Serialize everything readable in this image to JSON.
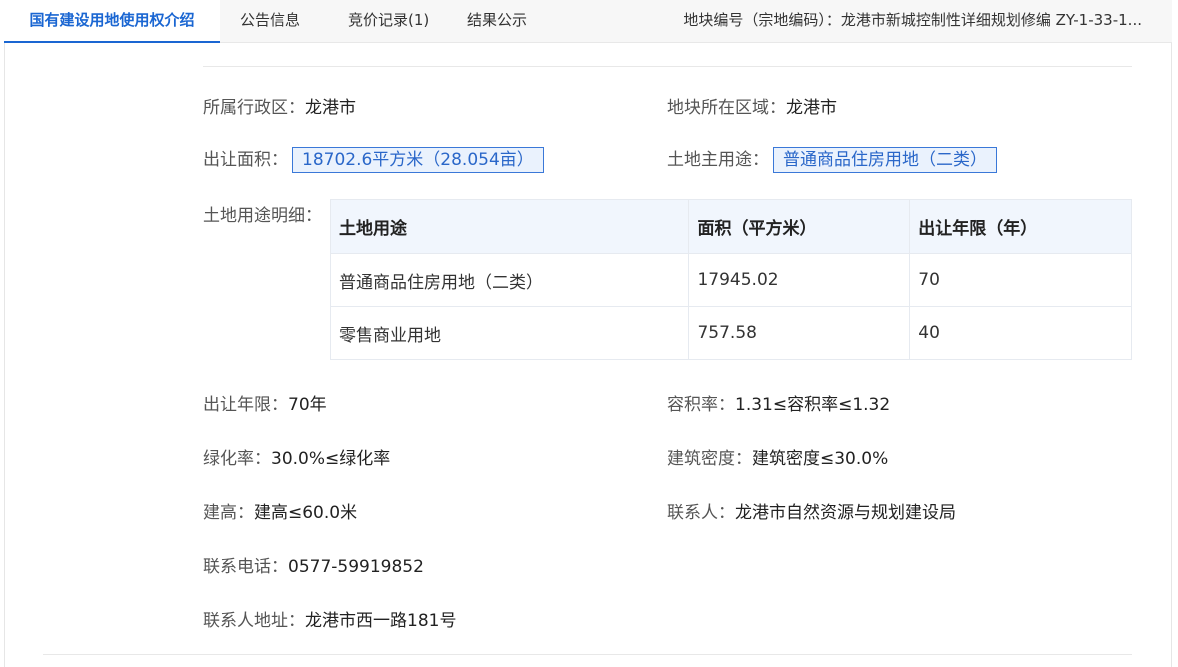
{
  "tabs": [
    {
      "label": "国有建设用地使用权介绍"
    },
    {
      "label": "公告信息"
    },
    {
      "label": "竞价记录(1)"
    },
    {
      "label": "结果公示"
    }
  ],
  "parcel": {
    "label": "地块编号（宗地编码）：",
    "value": "龙港市新城控制性详细规划修编 ZY-1-33-1..."
  },
  "info": {
    "district": {
      "label": "所属行政区：",
      "value": "龙港市"
    },
    "region": {
      "label": "地块所在区域：",
      "value": "龙港市"
    },
    "area": {
      "label": "出让面积：",
      "value": "18702.6平方米（28.054亩）"
    },
    "main_use": {
      "label": "土地主用途：",
      "value": "普通商品住房用地（二类）"
    },
    "detail_label": "土地用途明细：",
    "term": {
      "label": "出让年限：",
      "value": "70年"
    },
    "plot_ratio": {
      "label": "容积率：",
      "value": "1.31≤容积率≤1.32"
    },
    "green_ratio": {
      "label": "绿化率：",
      "value": "30.0%≤绿化率"
    },
    "density": {
      "label": "建筑密度：",
      "value": "建筑密度≤30.0%"
    },
    "height": {
      "label": "建高：",
      "value": "建高≤60.0米"
    },
    "contact": {
      "label": "联系人：",
      "value": "龙港市自然资源与规划建设局"
    },
    "phone": {
      "label": "联系电话：",
      "value": "0577-59919852"
    },
    "address": {
      "label": "联系人地址：",
      "value": "龙港市西一路181号"
    }
  },
  "detail_table": {
    "headers": [
      "土地用途",
      "面积（平方米）",
      "出让年限（年）"
    ],
    "rows": [
      [
        "普通商品住房用地（二类）",
        "17945.02",
        "70"
      ],
      [
        "零售商业用地",
        "757.58",
        "40"
      ]
    ]
  },
  "colors": {
    "accent": "#1a66d2",
    "tag_border": "#3a78d8",
    "tag_bg": "#eaf2fd",
    "table_header_bg": "#f1f6fd"
  }
}
